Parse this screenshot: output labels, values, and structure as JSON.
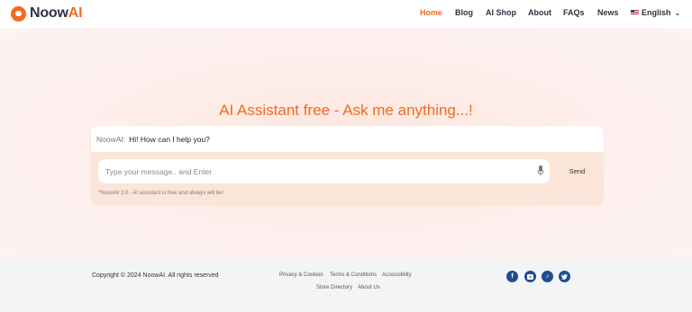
{
  "brand": {
    "name_prefix": "Noow",
    "name_suffix": "AI",
    "accent": "#f26a21"
  },
  "nav": {
    "items": [
      "Home",
      "Blog",
      "AI Shop",
      "About",
      "FAQs",
      "News"
    ],
    "active": "Home",
    "language": "English"
  },
  "hero": {
    "title": "AI Assistant free - Ask me anything...!",
    "bot_name": "NoowAI:",
    "bot_message": "Hi! How can I help you?",
    "input_placeholder": "Type your message.. and Enter",
    "input_value": "",
    "send_label": "Send",
    "note": "*NoowAI 2.0 - AI assistant is free and always will be!"
  },
  "footer": {
    "copyright": "Copyright © 2024 NoowAI. All rights reserved",
    "links": [
      "Privacy & Cookies",
      "Terms & Conditions",
      "Accessibility",
      "Store Directory",
      "About Us"
    ],
    "social_icons": [
      "facebook-icon",
      "youtube-icon",
      "tiktok-icon",
      "twitter-icon"
    ],
    "social_color": "#1f4e8c"
  }
}
